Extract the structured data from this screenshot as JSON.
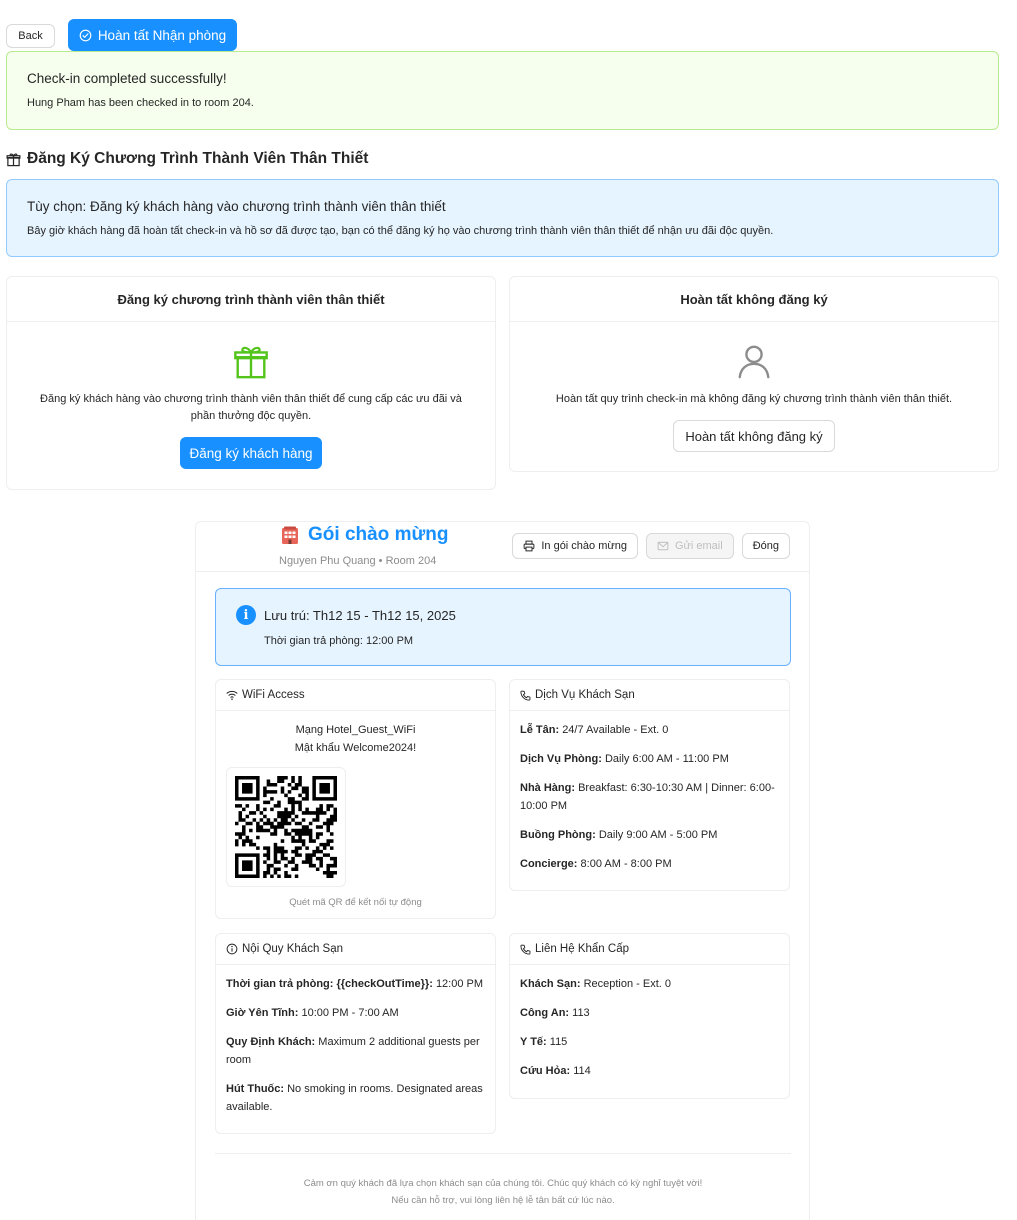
{
  "toolbar": {
    "back_label": "Back",
    "complete_label": "Hoàn tất Nhận phòng"
  },
  "success": {
    "title": "Check-in completed successfully!",
    "message": "Hung Pham has been checked in to room 204."
  },
  "loyalty": {
    "section_title": "Đăng Ký Chương Trình Thành Viên Thân Thiết",
    "info_title": "Tùy chọn: Đăng ký khách hàng vào chương trình thành viên thân thiết",
    "info_desc": "Bây giờ khách hàng đã hoàn tất check-in và hồ sơ đã được tạo, bạn có thể đăng ký họ vào chương trình thành viên thân thiết để nhận ưu đãi độc quyền.",
    "register_card": {
      "title": "Đăng ký chương trình thành viên thân thiết",
      "desc": "Đăng ký khách hàng vào chương trình thành viên thân thiết để cung cấp các ưu đãi và phần thưởng độc quyền.",
      "button": "Đăng ký khách hàng"
    },
    "skip_card": {
      "title": "Hoàn tất không đăng ký",
      "desc": "Hoàn tất quy trình check-in mà không đăng ký chương trình thành viên thân thiết.",
      "button": "Hoàn tất không đăng ký"
    }
  },
  "welcome": {
    "title": "Gói chào mừng",
    "subtitle": "Nguyen Phu Quang • Room 204",
    "print_label": "In gói chào mừng",
    "email_label": "Gửi email",
    "close_label": "Đóng",
    "stay_title": "Lưu trú: Th12 15 - Th12 15, 2025",
    "stay_checkout": "Thời gian trả phòng: 12:00 PM",
    "wifi": {
      "title": "WiFi Access",
      "network": "Mạng Hotel_Guest_WiFi",
      "password": "Mật khẩu Welcome2024!",
      "hint": "Quét mã QR để kết nối tự động"
    },
    "services": {
      "title": "Dịch Vụ Khách Sạn",
      "items": [
        {
          "label": "Lễ Tân:",
          "value": "24/7 Available - Ext. 0"
        },
        {
          "label": "Dịch Vụ Phòng:",
          "value": "Daily 6:00 AM - 11:00 PM"
        },
        {
          "label": "Nhà Hàng:",
          "value": "Breakfast: 6:30-10:30 AM | Dinner: 6:00-10:00 PM"
        },
        {
          "label": "Buồng Phòng:",
          "value": "Daily 9:00 AM - 5:00 PM"
        },
        {
          "label": "Concierge:",
          "value": "8:00 AM - 8:00 PM"
        }
      ]
    },
    "rules": {
      "title": "Nội Quy Khách Sạn",
      "items": [
        {
          "label": "Thời gian trả phòng: {{checkOutTime}}:",
          "value": "12:00 PM"
        },
        {
          "label": "Giờ Yên Tĩnh:",
          "value": "10:00 PM - 7:00 AM"
        },
        {
          "label": "Quy Định Khách:",
          "value": "Maximum 2 additional guests per room"
        },
        {
          "label": "Hút Thuốc:",
          "value": "No smoking in rooms. Designated areas available."
        }
      ]
    },
    "emergency": {
      "title": "Liên Hệ Khẩn Cấp",
      "items": [
        {
          "label": "Khách Sạn:",
          "value": "Reception - Ext. 0"
        },
        {
          "label": "Công An:",
          "value": "113"
        },
        {
          "label": "Y Tế:",
          "value": "115"
        },
        {
          "label": "Cứu Hỏa:",
          "value": "114"
        }
      ]
    },
    "footer_line1": "Cảm ơn quý khách đã lựa chọn khách sạn của chúng tôi. Chúc quý khách có kỳ nghỉ tuyệt vời!",
    "footer_line2": "Nếu cần hỗ trợ, vui lòng liên hệ lễ tân bất cứ lúc nào."
  },
  "colors": {
    "primary": "#1890ff",
    "success_bg": "#f6ffed",
    "info_bg": "#e6f4ff",
    "gift_green": "#52c41a"
  }
}
